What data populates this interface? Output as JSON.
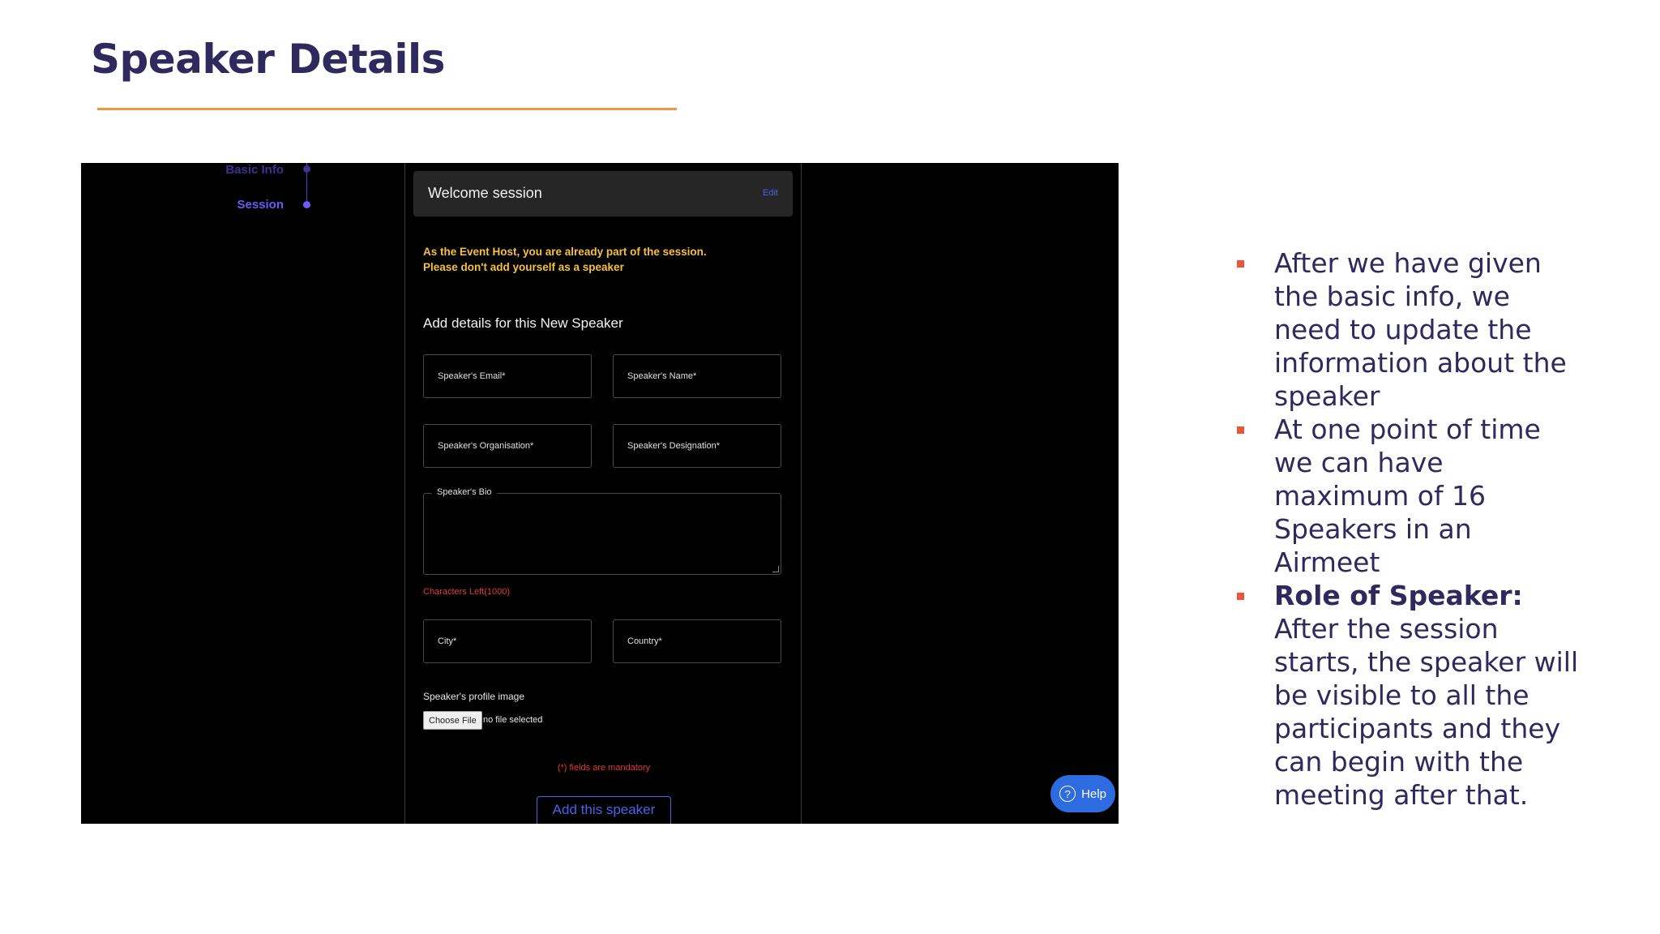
{
  "slide": {
    "title": "Speaker Details",
    "accent_color": "#f0954a",
    "title_color": "#2e2a5e"
  },
  "screenshot": {
    "stepper": {
      "steps": [
        "Basic Info",
        "Session"
      ]
    },
    "session_bar": {
      "name": "Welcome session",
      "edit_label": "Edit"
    },
    "warning_line1": "As the Event Host, you are already part of the session.",
    "warning_line2": "Please don't add yourself as a speaker",
    "form_heading": "Add details for this New Speaker",
    "fields": {
      "email_placeholder": "Speaker's Email*",
      "name_placeholder": "Speaker's Name*",
      "organisation_placeholder": "Speaker's Organisation*",
      "designation_placeholder": "Speaker's Designation*",
      "bio_label": "Speaker's Bio",
      "characters_left": "Characters Left(1000)",
      "city_placeholder": "City*",
      "country_placeholder": "Country*"
    },
    "profile_image": {
      "label": "Speaker's profile image",
      "choose_file": "Choose File",
      "status": "no file selected"
    },
    "mandatory_note": "(*) fields are mandatory",
    "add_button": "Add this speaker",
    "help_button": "Help",
    "help_icon": "?"
  },
  "bullets": [
    {
      "lead": "",
      "text": "After we have given the basic info, we need to update the information about the speaker"
    },
    {
      "lead": "",
      "text": "At one point of time we can have maximum of 16 Speakers in an Airmeet"
    },
    {
      "lead": "Role of Speaker:",
      "text": " After the session starts, the speaker will be visible to all the participants and they can begin with the meeting after that."
    }
  ]
}
